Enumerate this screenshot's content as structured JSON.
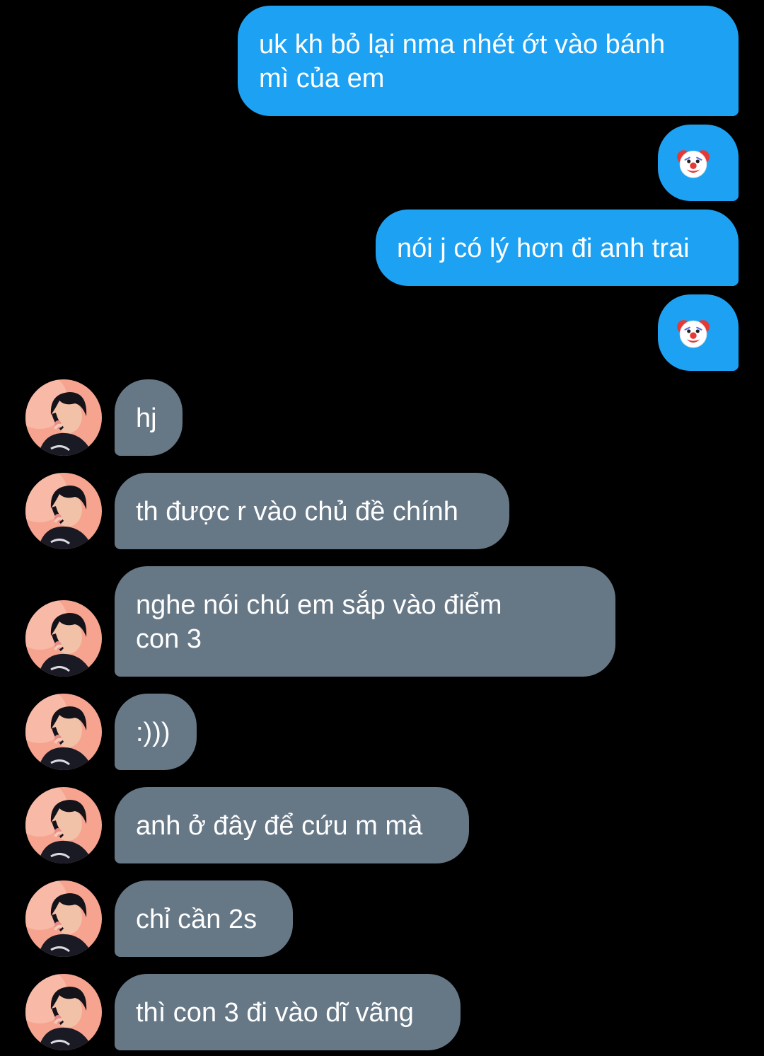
{
  "theme": {
    "background": "#000000",
    "outgoing_bubble": "#1da1f2",
    "incoming_bubble": "#667786",
    "text": "#ffffff"
  },
  "messages": [
    {
      "direction": "outgoing",
      "text": "uk kh bỏ lại nma nhét ớt vào bánh\nmì của em"
    },
    {
      "direction": "outgoing",
      "type": "emoji",
      "icon": "clown-face-icon"
    },
    {
      "direction": "outgoing",
      "text": "nói j có lý hơn đi anh trai"
    },
    {
      "direction": "outgoing",
      "type": "emoji",
      "icon": "clown-face-icon"
    },
    {
      "direction": "incoming",
      "text": "hj",
      "avatar": "contact-avatar"
    },
    {
      "direction": "incoming",
      "text": "th được r vào chủ đề chính",
      "avatar": "contact-avatar"
    },
    {
      "direction": "incoming",
      "text": "nghe nói chú em sắp vào điểm\ncon 3",
      "avatar": "contact-avatar"
    },
    {
      "direction": "incoming",
      "text": ":)))",
      "avatar": "contact-avatar"
    },
    {
      "direction": "incoming",
      "text": "anh ở đây để cứu m mà",
      "avatar": "contact-avatar"
    },
    {
      "direction": "incoming",
      "text": "chỉ cần 2s",
      "avatar": "contact-avatar"
    },
    {
      "direction": "incoming",
      "text": "thì con 3 đi vào dĩ vãng",
      "avatar": "contact-avatar"
    }
  ]
}
